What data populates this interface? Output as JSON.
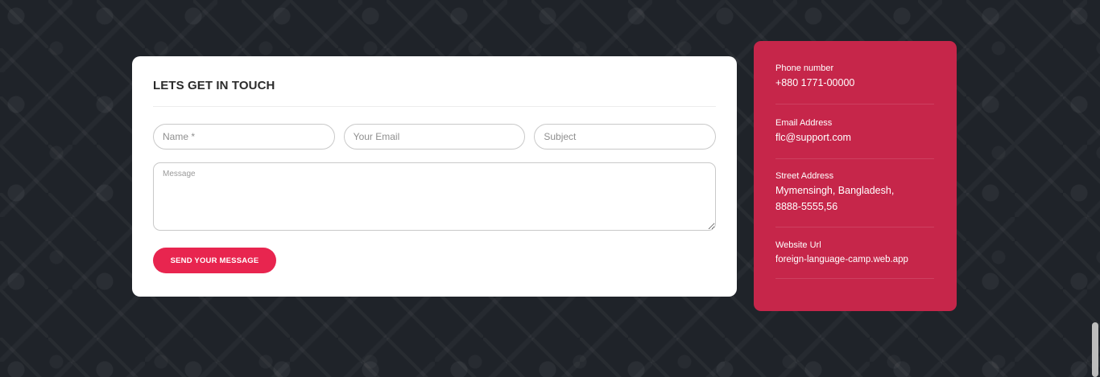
{
  "contact_form": {
    "title": "LETS GET IN TOUCH",
    "name_placeholder": "Name *",
    "email_placeholder": "Your Email",
    "subject_placeholder": "Subject",
    "message_placeholder": "Message",
    "submit_label": "SEND YOUR MESSAGE"
  },
  "contact_info": {
    "phone": {
      "label": "Phone number",
      "value": "+880 1771-00000"
    },
    "email": {
      "label": "Email Address",
      "value": "flc@support.com"
    },
    "street": {
      "label": "Street Address",
      "line1": "Mymensingh, Bangladesh,",
      "line2": "8888-5555,56"
    },
    "website": {
      "label": "Website Url",
      "value": "foreign-language-camp.web.app"
    }
  },
  "colors": {
    "background": "#1f2329",
    "accent_button": "#e8254f",
    "info_panel": "#c6264a"
  }
}
